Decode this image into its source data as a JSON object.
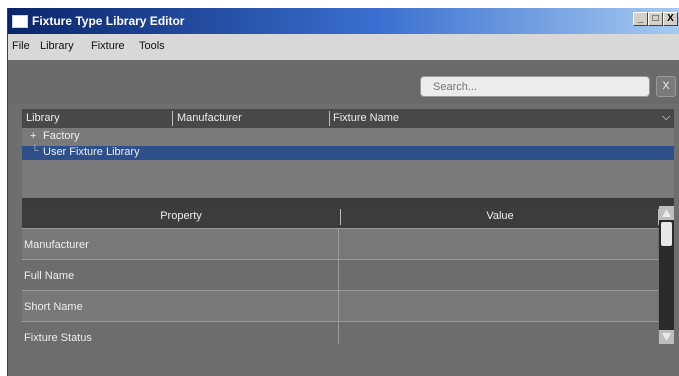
{
  "window": {
    "title": "Fixture Type Library Editor",
    "controls": [
      "_",
      "□",
      "X"
    ]
  },
  "menu": [
    "File",
    "Library",
    "Fixture",
    "Tools"
  ],
  "search": {
    "placeholder": "Search...",
    "clear_label": "X"
  },
  "tree": {
    "columns": [
      "Library",
      "Manufacturer",
      "Fixture Name"
    ],
    "rows": [
      {
        "prefix": "+",
        "label": "Factory",
        "selected": false
      },
      {
        "prefix": "└",
        "label": "User Fixture Library",
        "selected": true
      }
    ]
  },
  "properties": {
    "columns": [
      "Property",
      "Value"
    ],
    "rows": [
      {
        "property": "Manufacturer",
        "value": ""
      },
      {
        "property": "Full Name",
        "value": ""
      },
      {
        "property": "Short Name",
        "value": ""
      },
      {
        "property": "Fixture Status",
        "value": ""
      }
    ]
  },
  "colors": {
    "selection": "#2d4f8a",
    "title_bar": "#0a246a"
  }
}
